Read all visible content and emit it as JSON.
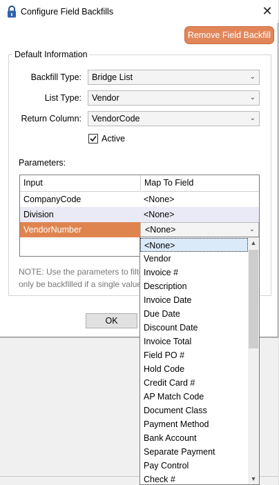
{
  "window": {
    "title": "Configure Field Backfills",
    "close_glyph": "✕"
  },
  "toolbar": {
    "remove_label": "Remove Field Backfill"
  },
  "group": {
    "legend": "Default Information"
  },
  "form": {
    "backfill_type_label": "Backfill Type:",
    "backfill_type_value": "Bridge List",
    "list_type_label": "List Type:",
    "list_type_value": "Vendor",
    "return_column_label": "Return Column:",
    "return_column_value": "VendorCode",
    "active_label": "Active",
    "active_checked": true
  },
  "parameters": {
    "label": "Parameters:",
    "columns": [
      "Input",
      "Map To Field"
    ],
    "rows": [
      {
        "input": "CompanyCode",
        "map": "<None>"
      },
      {
        "input": "Division",
        "map": "<None>"
      },
      {
        "input": "VendorNumber",
        "map": "<None>"
      }
    ]
  },
  "note": {
    "line1": "NOTE: Use the parameters to filter",
    "line2": "only be backfilled if a single value"
  },
  "footer": {
    "ok_label": "OK"
  },
  "dropdown": {
    "selected": "<None>",
    "options": [
      "<None>",
      "Vendor",
      "Invoice #",
      "Description",
      "Invoice Date",
      "Due Date",
      "Discount Date",
      "Invoice Total",
      "Field PO #",
      "Hold Code",
      "Credit Card #",
      "AP Match Code",
      "Document Class",
      "Payment Method",
      "Bank Account",
      "Separate Payment",
      "Pay Control",
      "Check #"
    ]
  },
  "colors": {
    "accent": "#e2865a",
    "selected_row": "#e0844f",
    "alt_row": "#eaeaf6"
  },
  "icons": {
    "title": "lock-icon",
    "chevron": "chevron-down-icon",
    "check": "checkmark-icon"
  }
}
